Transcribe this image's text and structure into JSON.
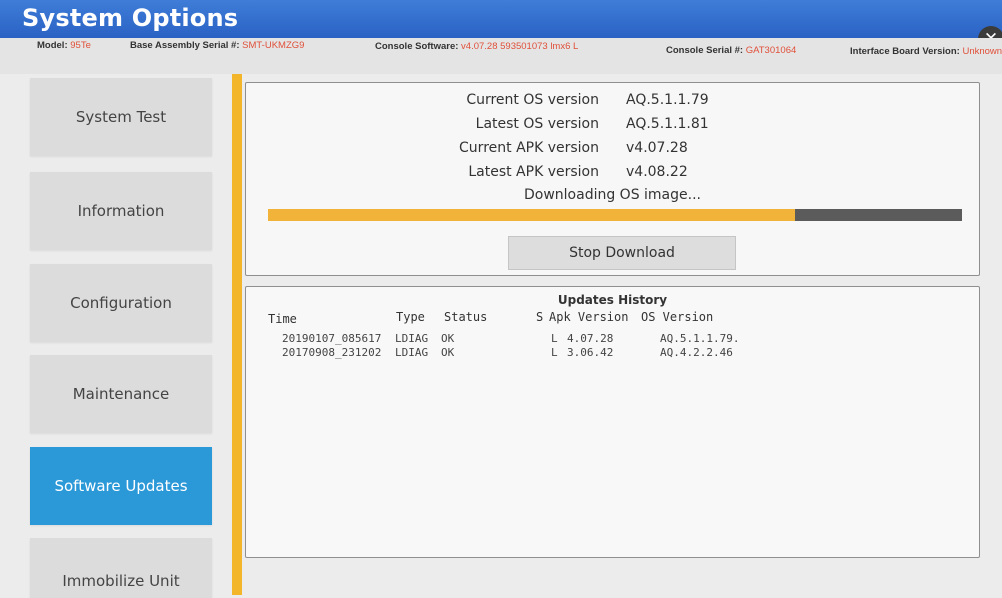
{
  "window": {
    "title": "System Options",
    "close_glyph": "✕"
  },
  "info_bar": {
    "model_label": "Model:",
    "model_value": "95Te",
    "base_serial_label": "Base Assembly Serial #:",
    "base_serial_value": "SMT-UKMZG9",
    "console_software_label": "Console Software:",
    "console_software_value": "v4.07.28 593501073 lmx6 L",
    "console_serial_label": "Console Serial #:",
    "console_serial_value": "GAT301064",
    "interface_board_label": "Interface Board Version:",
    "interface_board_value": "Unknown"
  },
  "sidebar": {
    "items": [
      {
        "label": "System Test"
      },
      {
        "label": "Information"
      },
      {
        "label": "Configuration"
      },
      {
        "label": "Maintenance"
      },
      {
        "label": "Software Updates",
        "active": true
      },
      {
        "label": "Immobilize Unit"
      }
    ]
  },
  "versions": {
    "current_os_label": "Current OS version",
    "current_os_value": "AQ.5.1.1.79",
    "latest_os_label": "Latest OS version",
    "latest_os_value": "AQ.5.1.1.81",
    "current_apk_label": "Current APK version",
    "current_apk_value": "v4.07.28",
    "latest_apk_label": "Latest APK version",
    "latest_apk_value": "v4.08.22"
  },
  "download": {
    "status": "Downloading OS image...",
    "progress_fraction": 0.76,
    "stop_label": "Stop Download"
  },
  "history": {
    "title": "Updates History",
    "columns": {
      "time": "Time",
      "type": "Type",
      "status": "Status",
      "s": "S",
      "apk": "Apk Version",
      "os": "OS Version"
    },
    "rows": [
      {
        "time": "20190107_085617",
        "type": "LDIAG",
        "status": "OK",
        "s": "L",
        "apk": "4.07.28",
        "os": "AQ.5.1.1.79."
      },
      {
        "time": "20170908_231202",
        "type": "LDIAG",
        "status": "OK",
        "s": "L",
        "apk": "3.06.42",
        "os": "AQ.4.2.2.46"
      }
    ]
  },
  "colors": {
    "title_bar": "#2f6ccc",
    "active_nav": "#2b98d8",
    "accent_divider": "#f3b62b",
    "progress_fill": "#f1b33a",
    "progress_track": "#5b5b5b",
    "info_value": "#e0503a"
  }
}
